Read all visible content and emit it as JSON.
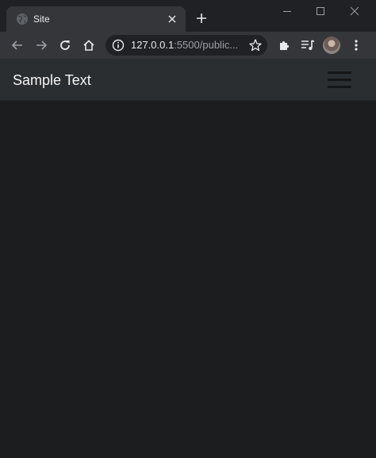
{
  "browser": {
    "tab": {
      "title": "Site",
      "favicon": "globe-icon"
    },
    "address": {
      "host": "127.0.0.1",
      "path": ":5500/public..."
    }
  },
  "site": {
    "navbar": {
      "brand": "Sample Text"
    }
  },
  "colors": {
    "tab_strip": "#202124",
    "toolbar": "#35363a",
    "page_background": "#1c1d1f",
    "navbar_background": "#2b2e31",
    "toggler_bars": "#141516"
  }
}
